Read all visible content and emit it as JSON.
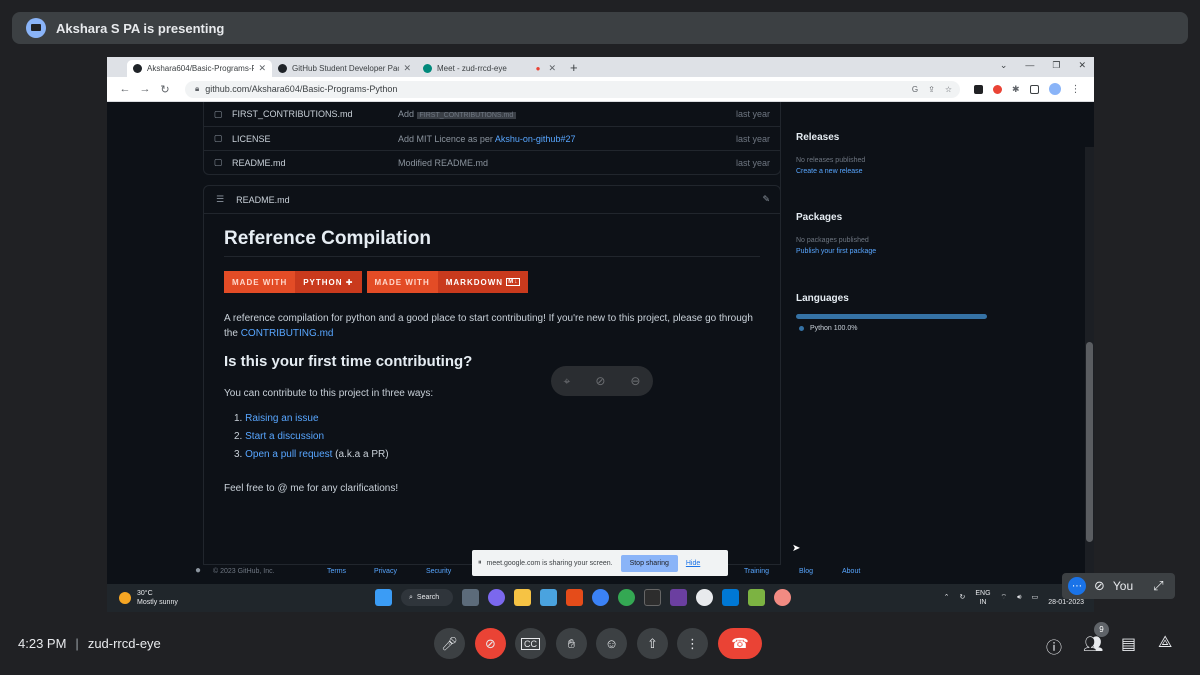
{
  "presenter": {
    "text": "Akshara S PA is presenting"
  },
  "browser": {
    "tabs": [
      {
        "title": "Akshara604/Basic-Programs-Pyt",
        "active": true,
        "favicon_color": "#1f2328"
      },
      {
        "title": "GitHub Student Developer Pack",
        "active": false,
        "favicon_color": "#1f2328"
      },
      {
        "title": "Meet - zud-rrcd-eye",
        "active": false,
        "favicon_color": "#00897b",
        "recording_icon": "●"
      }
    ],
    "new_tab": "+",
    "url": "github.com/Akshara604/Basic-Programs-Python"
  },
  "files": [
    {
      "name": "FIRST_CONTRIBUTIONS.md",
      "message": "Add",
      "blurred": "FIRST_CONTRIBUTIONS.md",
      "date": "last year"
    },
    {
      "name": "LICENSE",
      "message": "Add MIT Licence as per",
      "link": "Akshu-on-github#27",
      "date": "last year"
    },
    {
      "name": "README.md",
      "message": "Modified README.md",
      "date": "last year"
    }
  ],
  "readme": {
    "filename": "README.md",
    "title": "Reference Compilation",
    "badges": [
      {
        "left": "MADE WITH",
        "right": "PYTHON"
      },
      {
        "left": "MADE WITH",
        "right": "MARKDOWN"
      }
    ],
    "intro_text": "A reference compilation for python and a good place to start contributing! If you're new to this project, please go through the",
    "intro_link": "CONTRIBUTING.md",
    "h2": "Is this your first time contributing?",
    "ways_text": "You can contribute to this project in three ways:",
    "ways": [
      {
        "num": "1.",
        "link": "Raising an issue",
        "suffix": ""
      },
      {
        "num": "2.",
        "link": "Start a discussion",
        "suffix": ""
      },
      {
        "num": "3.",
        "link": "Open a pull request",
        "suffix": " (a.k.a a PR)"
      }
    ],
    "closing": "Feel free to @ me for any clarifications!"
  },
  "sidebar": {
    "releases": {
      "heading": "Releases",
      "status": "No releases published",
      "link": "Create a new release"
    },
    "packages": {
      "heading": "Packages",
      "status": "No packages published",
      "link": "Publish your first package"
    },
    "languages": {
      "heading": "Languages",
      "item": "Python 100.0%",
      "python_share": 100
    }
  },
  "footer": {
    "copyright": "© 2023 GitHub, Inc.",
    "links": [
      "Terms",
      "Privacy",
      "Security",
      "Training",
      "Blog",
      "About"
    ]
  },
  "share_banner": {
    "text": "meet.google.com is sharing your screen.",
    "stop": "Stop sharing",
    "hide": "Hide"
  },
  "taskbar": {
    "weather_temp": "30°C",
    "weather_desc": "Mostly sunny",
    "search": "Search",
    "lang_top": "ENG",
    "lang_bottom": "IN",
    "date": "28-01-2023"
  },
  "self_tile": {
    "name": "You"
  },
  "meeting": {
    "time": "4:23 PM",
    "code": "zud-rrcd-eye",
    "participants_count": "9"
  },
  "colors": {
    "end_call": "#ea4335",
    "link": "#58a6ff",
    "badge_left": "#e34c26",
    "badge_right": "#c93a1d"
  }
}
